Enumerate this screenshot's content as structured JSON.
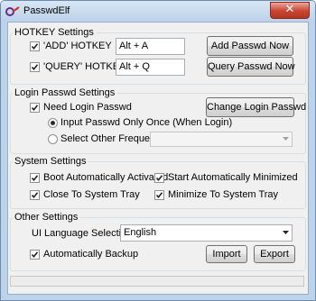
{
  "window": {
    "title": "PasswdElf",
    "close_label": "✕",
    "app_icon": "passwdelf-app-icon"
  },
  "hotkey": {
    "title": "HOTKEY Settings",
    "add": {
      "label": "'ADD'  HOTKEY",
      "checked": true,
      "value": "Alt + A",
      "button": "Add Passwd Now"
    },
    "query": {
      "label": "'QUERY'  HOTKEY",
      "checked": true,
      "value": "Alt + Q",
      "button": "Query Passwd Now"
    }
  },
  "login": {
    "title": "Login Passwd Settings",
    "need_login": {
      "label": "Need Login Passwd",
      "checked": true
    },
    "change_button": "Change Login Passwd",
    "once": {
      "label": "Input Passwd Only Once (When Login)",
      "selected": true
    },
    "other": {
      "label": "Select Other Frequency",
      "selected": false,
      "value": ""
    }
  },
  "system": {
    "title": "System Settings",
    "boot": {
      "label": "Boot Automatically Activated",
      "checked": true
    },
    "start_min": {
      "label": "Start Automatically Minimized",
      "checked": true
    },
    "close_tray": {
      "label": "Close To System Tray",
      "checked": true
    },
    "min_tray": {
      "label": "Minimize To System Tray",
      "checked": true
    }
  },
  "other": {
    "title": "Other Settings",
    "language": {
      "label": "UI Language Selection",
      "value": "English"
    },
    "backup": {
      "label": "Automatically Backup",
      "checked": true
    },
    "import_button": "Import",
    "export_button": "Export"
  },
  "status": {
    "text": ""
  }
}
